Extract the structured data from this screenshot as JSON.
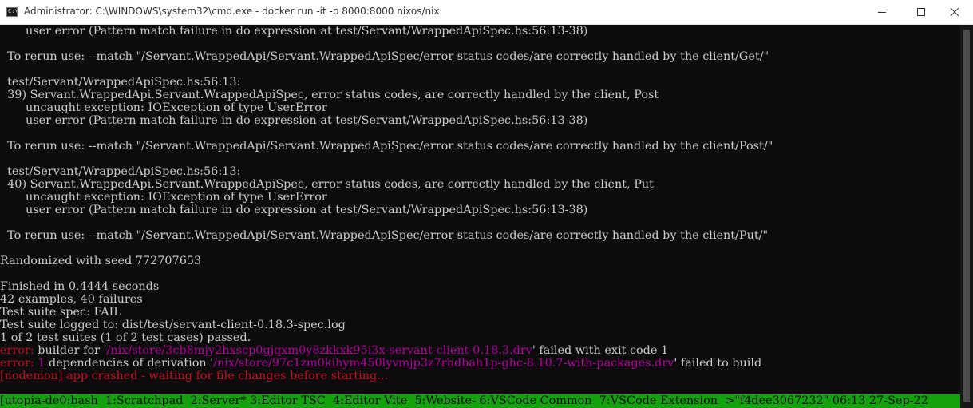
{
  "window": {
    "title": "Administrator: C:\\WINDOWS\\system32\\cmd.exe - docker  run -it -p 8000:8000 nixos/nix",
    "icon": "cmd-icon",
    "icon_text": "C:\\_",
    "controls": [
      "minimize-icon",
      "maximize-icon",
      "close-icon"
    ]
  },
  "colors": {
    "background": "#0c0c0c",
    "text": "#cccccc",
    "error_red": "#c50f1f",
    "path_magenta": "#b4009e",
    "status_green": "#13a10e"
  },
  "terminal": {
    "lines": [
      "       user error (Pattern match failure in do expression at test/Servant/WrappedApiSpec.hs:56:13-38)",
      "",
      "  To rerun use: --match \"/Servant.WrappedApi/Servant.WrappedApiSpec/error status codes/are correctly handled by the client/Get/\"",
      "",
      "  test/Servant/WrappedApiSpec.hs:56:13:",
      "  39) Servant.WrappedApi.Servant.WrappedApiSpec, error status codes, are correctly handled by the client, Post",
      "       uncaught exception: IOException of type UserError",
      "       user error (Pattern match failure in do expression at test/Servant/WrappedApiSpec.hs:56:13-38)",
      "",
      "  To rerun use: --match \"/Servant.WrappedApi/Servant.WrappedApiSpec/error status codes/are correctly handled by the client/Post/\"",
      "",
      "  test/Servant/WrappedApiSpec.hs:56:13:",
      "  40) Servant.WrappedApi.Servant.WrappedApiSpec, error status codes, are correctly handled by the client, Put",
      "       uncaught exception: IOException of type UserError",
      "       user error (Pattern match failure in do expression at test/Servant/WrappedApiSpec.hs:56:13-38)",
      "",
      "  To rerun use: --match \"/Servant.WrappedApi/Servant.WrappedApiSpec/error status codes/are correctly handled by the client/Put/\"",
      "",
      "Randomized with seed 772707653",
      "",
      "Finished in 0.4444 seconds",
      "42 examples, 40 failures",
      "Test suite spec: FAIL",
      "Test suite logged to: dist/test/servant-client-0.18.3-spec.log",
      "1 of 2 test suites (1 of 2 test cases) passed."
    ],
    "error_builder": {
      "prefix": "error:",
      "before": " builder for '",
      "path": "/nix/store/3cb8mjy2hxscp0gjqxm0y8zkkxk95i3x-servant-client-0.18.3.drv",
      "after": "' failed with exit code 1"
    },
    "error_dependency": {
      "prefix": "error:",
      "count": " 1",
      "before": " dependencies of derivation '",
      "path": "/nix/store/97c1zm0kihym450lyvmjp3z7rhdbah1p-ghc-8.10.7-with-packages.drv",
      "after": "' failed to build"
    },
    "nodemon": "[nodemon] app crashed - waiting for file changes before starting..."
  },
  "statusbar": {
    "text": "[utopia-de0:bash  1:Scratchpad  2:Server* 3:Editor TSC  4:Editor Vite  5:Website- 6:VSCode Common  7:VSCode Extension  >\"f4dee3067232\" 06:13 27-Sep-22"
  }
}
